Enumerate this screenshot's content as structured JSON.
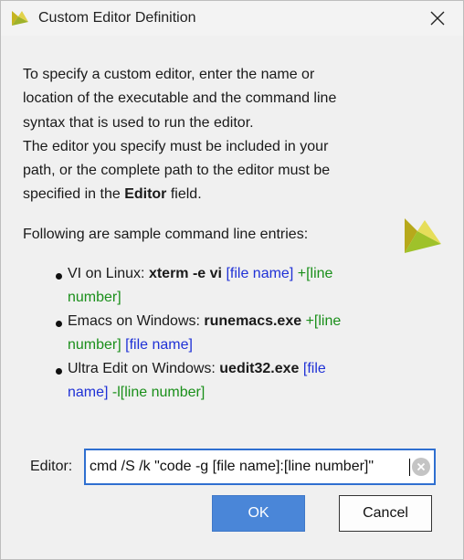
{
  "window": {
    "title": "Custom Editor Definition",
    "close_icon": "close-icon",
    "app_icon": "vivado-logo-icon"
  },
  "intro": {
    "line1": "To specify a custom editor, enter the name or",
    "line2": "location of the executable and the command line",
    "line3": "syntax that is used to run the editor.",
    "line4": "The editor you specify must be included in your",
    "line5": "path, or the complete path to the editor must be",
    "line6_pre": "specified in the ",
    "line6_bold": "Editor",
    "line6_post": " field."
  },
  "samples_heading": "Following are sample command line entries:",
  "samples": [
    {
      "prefix": "VI on Linux: ",
      "command": "xterm -e vi",
      "part1": "[file name]",
      "part2_a": "+[line",
      "part2_b": "number]"
    },
    {
      "prefix": "Emacs on Windows: ",
      "command": "runemacs.exe",
      "part1_a": "+[line",
      "part1_b": "number]",
      "part2": "[file name]"
    },
    {
      "prefix": "Ultra Edit on Windows: ",
      "command": "uedit32.exe",
      "part1_a": "[file",
      "part1_b": "name]",
      "part2": "-l[line number]"
    }
  ],
  "editor": {
    "label": "Editor:",
    "value": "cmd /S /k \"code -g [file name]:[line number]\""
  },
  "buttons": {
    "ok": "OK",
    "cancel": "Cancel"
  },
  "colors": {
    "file_token": "#1f31d6",
    "line_token": "#1a8f1a",
    "ok_bg": "#4a86d8",
    "focus_border": "#2f6fd0"
  }
}
